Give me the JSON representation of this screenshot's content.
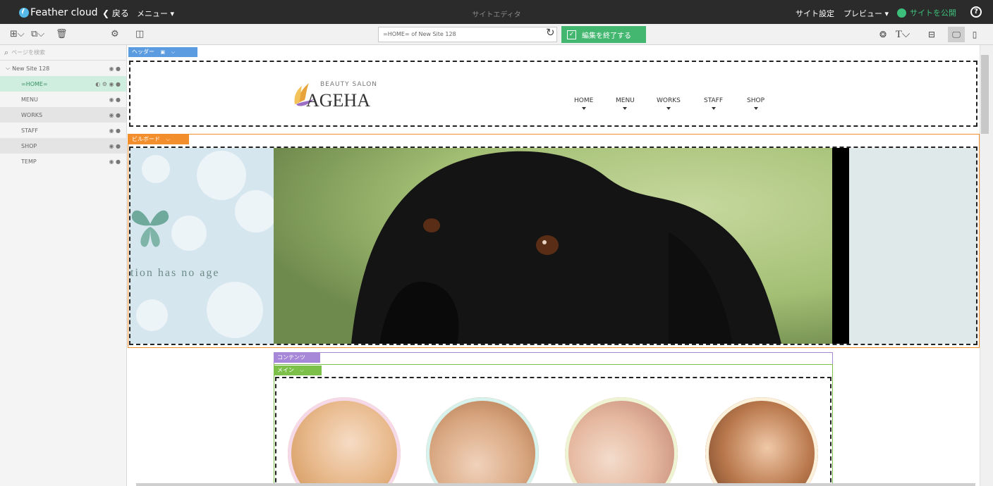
{
  "app": {
    "logo_text": "Feather cloud",
    "back_label": "戻る",
    "menu_label": "メニュー",
    "center_title": "サイトエディタ",
    "site_settings_label": "サイト設定",
    "preview_label": "プレビュー",
    "publish_label": "サイトを公開",
    "help_label": "?"
  },
  "toolbar": {
    "url_text": "=HOME= of New Site 128",
    "finish_label": "編集を終了する"
  },
  "sidebar": {
    "search_placeholder": "ページを検索",
    "site_name": "New Site 128",
    "pages": [
      {
        "label": "=HOME="
      },
      {
        "label": "MENU"
      },
      {
        "label": "WORKS"
      },
      {
        "label": "STAFF"
      },
      {
        "label": "SHOP"
      },
      {
        "label": "TEMP"
      }
    ]
  },
  "canvas": {
    "sections": {
      "header_tag": "ヘッダー",
      "billboard_tag": "ビルボード",
      "contents_tag": "コンテンツ",
      "main_tag": "メイン"
    },
    "site_header": {
      "brand_small": "BEAUTY SALON",
      "brand_name": "AGEHA",
      "nav": [
        "HOME",
        "MENU",
        "WORKS",
        "STAFF",
        "SHOP"
      ]
    },
    "billboard": {
      "tagline": "tion has no age"
    }
  },
  "colors": {
    "accent_green": "#43b770",
    "header_tag": "#5b9bdf",
    "billboard_tag": "#f28e2c",
    "contents_tag": "#a687d8",
    "main_tag": "#7cc04a",
    "selected_page_bg": "#cfeee0"
  }
}
